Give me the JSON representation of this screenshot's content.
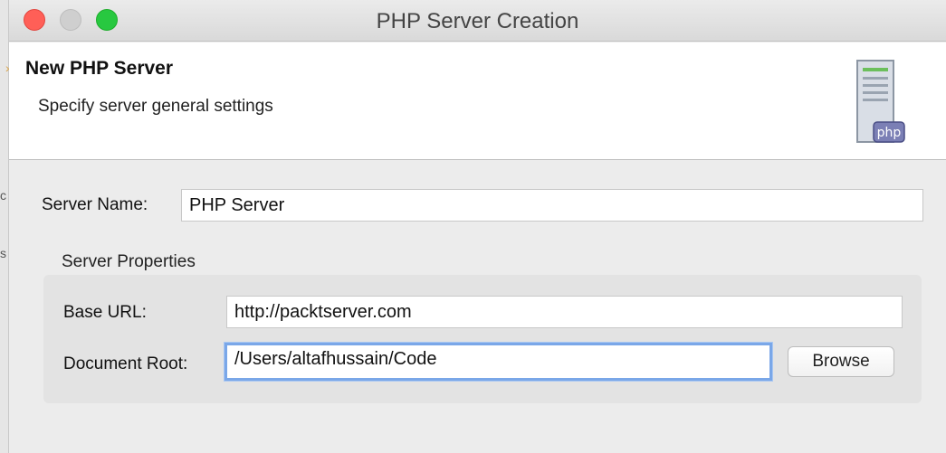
{
  "window": {
    "title": "PHP Server Creation"
  },
  "header": {
    "title": "New PHP Server",
    "subtitle": "Specify server general settings",
    "icon_label": "php"
  },
  "form": {
    "server_name_label": "Server Name:",
    "server_name_value": "PHP Server",
    "group_title": "Server Properties",
    "base_url_label": "Base URL:",
    "base_url_value": "http://packtserver.com",
    "document_root_label": "Document Root:",
    "document_root_value": "/Users/altafhussain/Code",
    "browse_label": "Browse"
  },
  "left_strip": {
    "frag_1": "c",
    "frag_2": "s"
  }
}
